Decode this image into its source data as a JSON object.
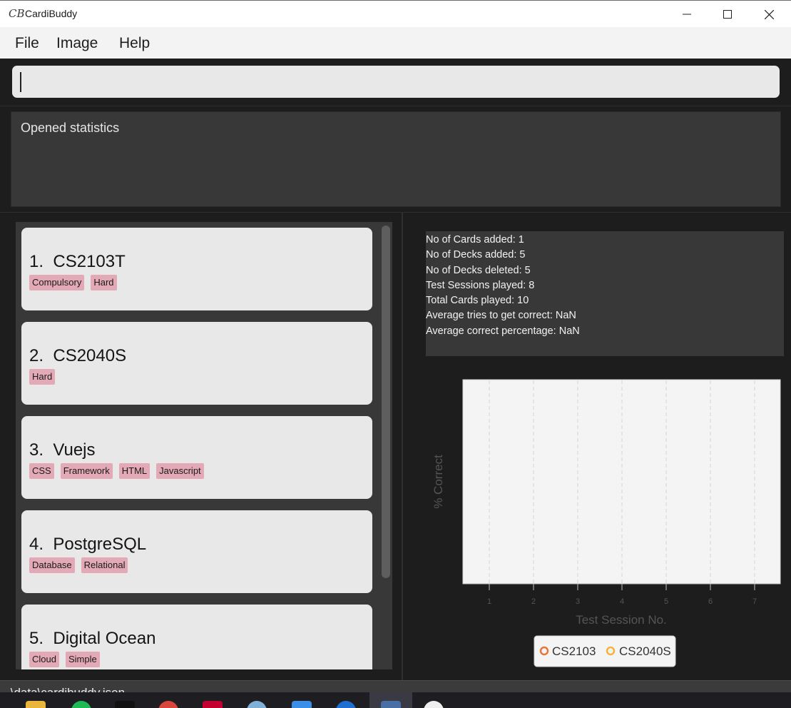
{
  "window": {
    "title": "CardiBuddy",
    "icon_text": "CB"
  },
  "menu": [
    "File",
    "Image",
    "Help"
  ],
  "command": {
    "value": ""
  },
  "result": {
    "text": "Opened statistics"
  },
  "decks": [
    {
      "index": "1.",
      "name": "CS2103T",
      "tags": [
        "Compulsory",
        "Hard"
      ]
    },
    {
      "index": "2.",
      "name": "CS2040S",
      "tags": [
        "Hard"
      ]
    },
    {
      "index": "3.",
      "name": "Vuejs",
      "tags": [
        "CSS",
        "Framework",
        "HTML",
        "Javascript"
      ]
    },
    {
      "index": "4.",
      "name": "PostgreSQL",
      "tags": [
        "Database",
        "Relational"
      ]
    },
    {
      "index": "5.",
      "name": "Digital Ocean",
      "tags": [
        "Cloud",
        "Simple"
      ]
    }
  ],
  "stats": [
    "No of Cards added: 1",
    "No of Decks added: 5",
    "No of Decks deleted: 5",
    "Test Sessions played: 8",
    "Total Cards played: 10",
    "Average tries to get correct: NaN",
    "Average correct percentage: NaN"
  ],
  "chart_data": {
    "type": "line",
    "xlabel": "Test Session No.",
    "ylabel": "% Correct",
    "x_ticks": [
      "1",
      "2",
      "3",
      "4",
      "5",
      "6",
      "7"
    ],
    "series": [
      {
        "name": "CS2103",
        "values": [],
        "color": "#e8743b"
      },
      {
        "name": "CS2040S",
        "values": [],
        "color": "#f2b43c"
      }
    ],
    "grid": true,
    "legend": "bottom"
  },
  "status": {
    "path": ".\\data\\cardibuddy.json"
  }
}
